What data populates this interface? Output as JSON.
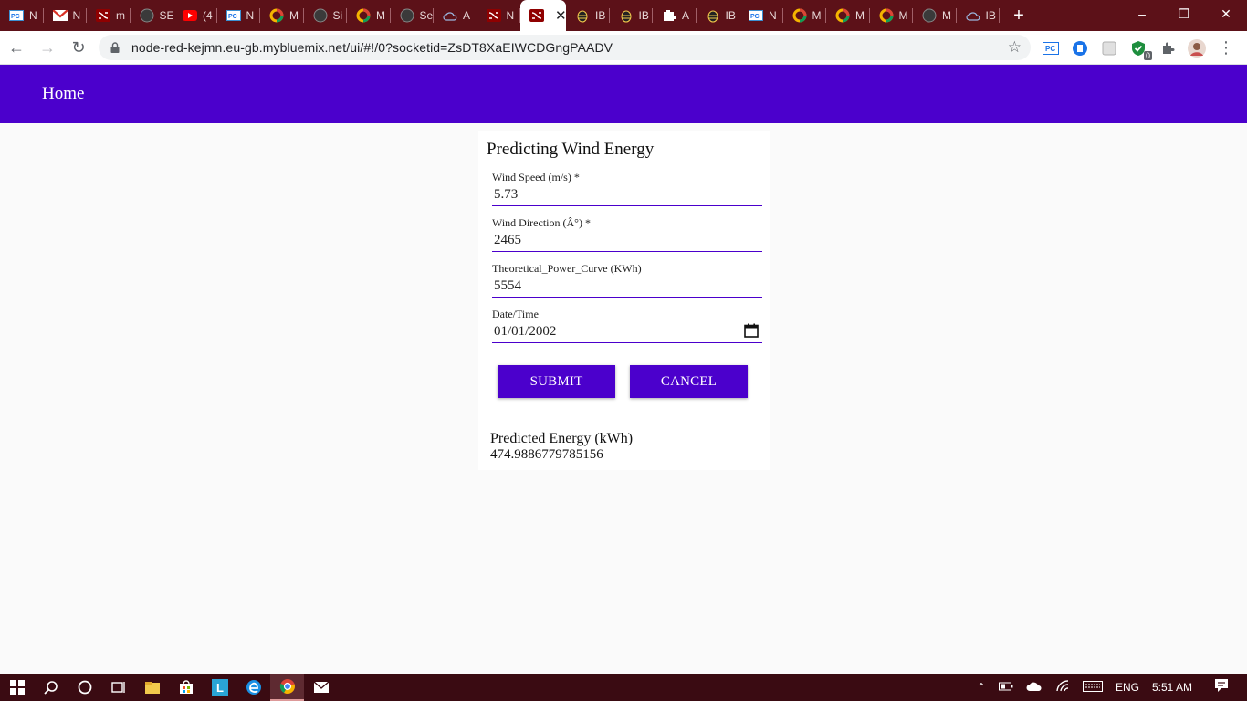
{
  "browser": {
    "tabs": [
      {
        "label": "N",
        "icon": "pc-icon"
      },
      {
        "label": "N",
        "icon": "gmail-icon"
      },
      {
        "label": "m",
        "icon": "node-red-icon"
      },
      {
        "label": "SE",
        "icon": "github-icon"
      },
      {
        "label": "(4",
        "icon": "youtube-icon"
      },
      {
        "label": "N",
        "icon": "pc-icon"
      },
      {
        "label": "M",
        "icon": "ring-icon"
      },
      {
        "label": "Si",
        "icon": "github-icon"
      },
      {
        "label": "M",
        "icon": "ring-icon"
      },
      {
        "label": "Se",
        "icon": "github-icon"
      },
      {
        "label": "A",
        "icon": "cloud-icon"
      },
      {
        "label": "N",
        "icon": "node-red-icon"
      },
      {
        "label": "",
        "icon": "node-red-icon",
        "active": true
      },
      {
        "label": "IB",
        "icon": "bee-icon"
      },
      {
        "label": "IB",
        "icon": "bee-icon"
      },
      {
        "label": "A",
        "icon": "puzzle-icon"
      },
      {
        "label": "IB",
        "icon": "bee-icon"
      },
      {
        "label": "N",
        "icon": "pc-icon"
      },
      {
        "label": "M",
        "icon": "ring-icon"
      },
      {
        "label": "M",
        "icon": "ring-icon"
      },
      {
        "label": "M",
        "icon": "ring-icon"
      },
      {
        "label": "M",
        "icon": "github-icon"
      },
      {
        "label": "IB",
        "icon": "cloud-icon"
      }
    ],
    "url": "node-red-kejmn.eu-gb.mybluemix.net/ui/#!/0?socketid=ZsDT8XaEIWCDGngPAADV",
    "ext_badge": "0"
  },
  "app": {
    "header_title": "Home",
    "accent_color": "#4b00cc"
  },
  "form": {
    "title": "Predicting Wind Energy",
    "fields": [
      {
        "label": "Wind Speed (m/s) *",
        "value": "5.73"
      },
      {
        "label": "Wind Direction (Â°) *",
        "value": "2465"
      },
      {
        "label": "Theoretical_Power_Curve (KWh)",
        "value": "5554"
      },
      {
        "label": "Date/Time",
        "value": "01/01/2002"
      }
    ],
    "submit_label": "SUBMIT",
    "cancel_label": "CANCEL"
  },
  "result": {
    "label": "Predicted Energy (kWh)",
    "value": "474.9886779785156"
  },
  "taskbar": {
    "language": "ENG",
    "time": "5:51 AM"
  }
}
